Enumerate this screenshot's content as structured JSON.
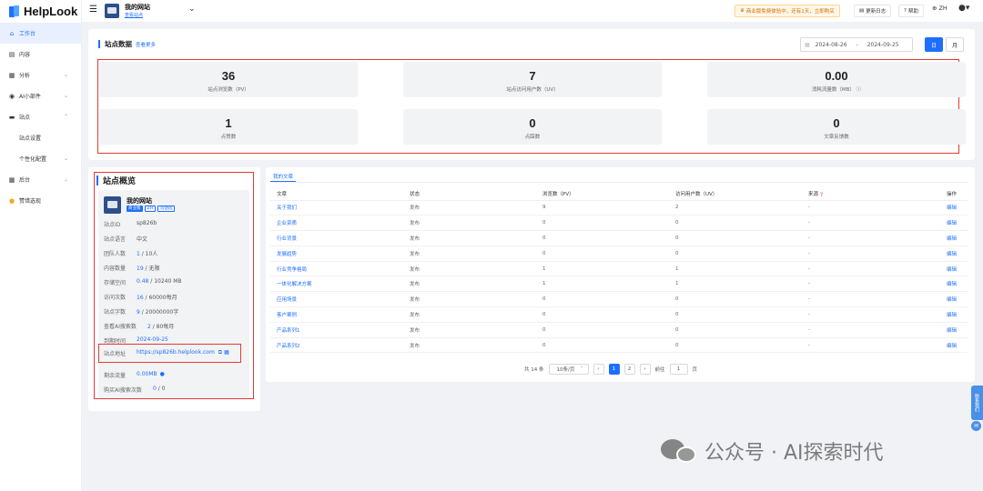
{
  "brand": {
    "name": "HelpLook"
  },
  "sidebar": {
    "items": [
      {
        "label": "工作台",
        "icon": "home-icon",
        "active": true
      },
      {
        "label": "内容",
        "icon": "content-icon"
      },
      {
        "label": "分析",
        "icon": "analytics-icon",
        "expandable": true
      },
      {
        "label": "AI小部件",
        "icon": "ai-widget-icon",
        "expandable": true
      },
      {
        "label": "站点",
        "icon": "site-icon",
        "expanded": true
      },
      {
        "label": "站点设置",
        "sub": true
      },
      {
        "label": "个性化配置",
        "sub": true,
        "expandable": true
      },
      {
        "label": "后台",
        "icon": "backend-icon",
        "expandable": true
      },
      {
        "label": "赞惜选现",
        "icon": "reward-icon"
      }
    ]
  },
  "topbar": {
    "site_name": "我的网站",
    "site_link": "查看站点",
    "trial_text": "商业版免费体验中，还有1天，立即购买",
    "changelog": "更新日志",
    "help": "帮助",
    "lang": "ZH"
  },
  "stats": {
    "title": "站点数据",
    "more": "查看更多",
    "date_start": "2024-08-26",
    "date_sep": "-",
    "date_end": "2024-09-25",
    "day_btn": "日",
    "month_btn": "月",
    "cards": [
      {
        "value": "36",
        "label": "站点浏览数（PV）"
      },
      {
        "value": "7",
        "label": "站点访问用户数（UV）"
      },
      {
        "value": "0.00",
        "label": "消耗流量数（MB）"
      },
      {
        "value": "1",
        "label": "点赞数"
      },
      {
        "value": "0",
        "label": "点踩数"
      },
      {
        "value": "0",
        "label": "文章反馈数"
      }
    ]
  },
  "overview": {
    "title": "站点概览",
    "site_name": "我的网站",
    "badges": [
      "商业版",
      "ZH",
      "可访问"
    ],
    "rows": [
      {
        "key": "站点ID",
        "value": "sp826b"
      },
      {
        "key": "站点语言",
        "value": "中文"
      },
      {
        "key": "团队人数",
        "hl": "1",
        "rest": " / 10人"
      },
      {
        "key": "内容数量",
        "hl": "19",
        "rest": " / 无限"
      },
      {
        "key": "存储空间",
        "hl": "0.48",
        "rest": " / 10240 MB"
      },
      {
        "key": "访问次数",
        "hl": "16",
        "rest": " / 60000每月"
      },
      {
        "key": "站点字数",
        "hl": "9",
        "rest": " / 20000000字"
      },
      {
        "key": "查看AI搜索数",
        "hl": "2",
        "rest": " / 80每月"
      },
      {
        "key": "到期时间",
        "value": "2024-09-25",
        "link": true
      },
      {
        "key": "站点地址",
        "value": "https://sp826b.helplook.com",
        "link": true
      },
      {
        "key": "剩余流量",
        "value": "0.00MB",
        "link": true
      },
      {
        "key": "购买AI搜索次数",
        "hl": "0",
        "rest": " / 0"
      }
    ]
  },
  "articles": {
    "tab": "我的文章",
    "columns": [
      "文章",
      "状态",
      "浏览数（PV）",
      "访问用户数（UV）",
      "来源",
      "操作"
    ],
    "rows": [
      {
        "title": "关于我们",
        "status": "发布",
        "pv": "9",
        "uv": "2",
        "source": "-",
        "op": "编辑"
      },
      {
        "title": "企业资质",
        "status": "发布",
        "pv": "0",
        "uv": "0",
        "source": "-",
        "op": "编辑"
      },
      {
        "title": "行业背景",
        "status": "发布",
        "pv": "0",
        "uv": "0",
        "source": "-",
        "op": "编辑"
      },
      {
        "title": "发展趋势",
        "status": "发布",
        "pv": "0",
        "uv": "0",
        "source": "-",
        "op": "编辑"
      },
      {
        "title": "行业竞争格局",
        "status": "发布",
        "pv": "1",
        "uv": "1",
        "source": "-",
        "op": "编辑"
      },
      {
        "title": "一体化解决方案",
        "status": "发布",
        "pv": "1",
        "uv": "1",
        "source": "-",
        "op": "编辑"
      },
      {
        "title": "应用场景",
        "status": "发布",
        "pv": "0",
        "uv": "0",
        "source": "-",
        "op": "编辑"
      },
      {
        "title": "客户案例",
        "status": "发布",
        "pv": "0",
        "uv": "0",
        "source": "-",
        "op": "编辑"
      },
      {
        "title": "产品系列1",
        "status": "发布",
        "pv": "0",
        "uv": "0",
        "source": "-",
        "op": "编辑"
      },
      {
        "title": "产品系列2",
        "status": "发布",
        "pv": "0",
        "uv": "0",
        "source": "-",
        "op": "编辑"
      }
    ],
    "pager": {
      "total": "共 14 条",
      "page_size": "10条/页",
      "pages": [
        "1",
        "2"
      ],
      "current": "1",
      "goto_label": "前往",
      "goto_value": "1",
      "page_unit": "页"
    }
  },
  "float_tab": "联系我们",
  "watermark": "公众号 · AI探索时代",
  "colors": {
    "accent": "#1e6fff",
    "highlight_box": "#e53935"
  }
}
